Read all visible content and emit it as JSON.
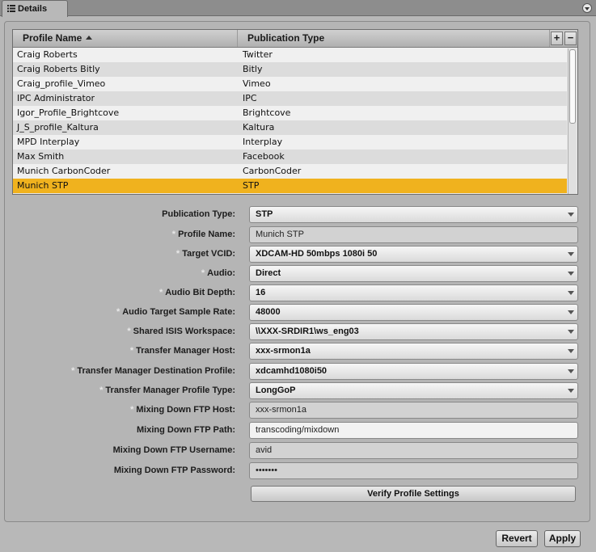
{
  "tab": {
    "label": "Details",
    "icon": "list-icon"
  },
  "table": {
    "columns": [
      "Profile Name",
      "Publication Type"
    ],
    "add_label": "+",
    "remove_label": "−",
    "rows": [
      {
        "name": "Craig Roberts",
        "type": "Twitter"
      },
      {
        "name": "Craig Roberts Bitly",
        "type": "Bitly"
      },
      {
        "name": "Craig_profile_Vimeo",
        "type": "Vimeo"
      },
      {
        "name": "IPC Administrator",
        "type": "IPC"
      },
      {
        "name": "Igor_Profile_Brightcove",
        "type": "Brightcove"
      },
      {
        "name": "J_S_profile_Kaltura",
        "type": "Kaltura"
      },
      {
        "name": "MPD Interplay",
        "type": "Interplay"
      },
      {
        "name": "Max Smith",
        "type": "Facebook"
      },
      {
        "name": "Munich CarbonCoder",
        "type": "CarbonCoder"
      },
      {
        "name": "Munich STP",
        "type": "STP"
      }
    ],
    "selected_index": 9,
    "selected_color": "#f0b21e"
  },
  "form": {
    "publication_type": {
      "label": "Publication Type:",
      "value": "STP"
    },
    "profile_name": {
      "label": "Profile Name:",
      "value": "Munich STP"
    },
    "target_vcid": {
      "label": "Target VCID:",
      "value": "XDCAM-HD 50mbps 1080i 50"
    },
    "audio": {
      "label": "Audio:",
      "value": "Direct"
    },
    "audio_bit_depth": {
      "label": "Audio Bit Depth:",
      "value": "16"
    },
    "audio_sample_rate": {
      "label": "Audio Target Sample Rate:",
      "value": "48000"
    },
    "shared_isis": {
      "label": "Shared ISIS Workspace:",
      "value": "\\\\XXX-SRDIR1\\ws_eng03"
    },
    "tm_host": {
      "label": "Transfer Manager Host:",
      "value": "xxx-srmon1a"
    },
    "tm_dest_profile": {
      "label": "Transfer Manager Destination Profile:",
      "value": "xdcamhd1080i50"
    },
    "tm_profile_type": {
      "label": "Transfer Manager Profile Type:",
      "value": "LongGoP"
    },
    "ftp_host": {
      "label": "Mixing Down FTP Host:",
      "value": "xxx-srmon1a"
    },
    "ftp_path": {
      "label": "Mixing Down FTP Path:",
      "value": "transcoding/mixdown"
    },
    "ftp_username": {
      "label": "Mixing Down FTP Username:",
      "value": "avid"
    },
    "ftp_password": {
      "label": "Mixing Down FTP Password:",
      "value": "•••••••"
    },
    "required_marker": "*"
  },
  "buttons": {
    "verify": "Verify Profile Settings",
    "revert": "Revert",
    "apply": "Apply"
  }
}
